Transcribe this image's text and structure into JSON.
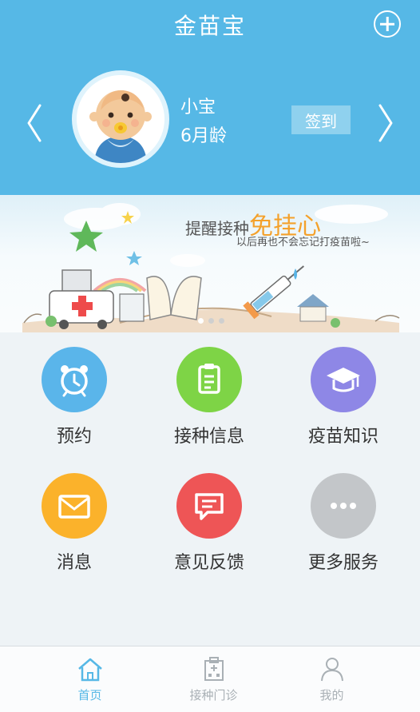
{
  "header": {
    "title": "金苗宝"
  },
  "profile": {
    "name": "小宝",
    "age": "6月龄",
    "checkin_label": "签到"
  },
  "banner": {
    "title_prefix": "提醒接种",
    "title_emphasis": "免挂心",
    "subtitle": "以后再也不会忘记打疫苗啦~",
    "slides": 3,
    "active_slide": 1
  },
  "grid": {
    "items": [
      {
        "label": "预约",
        "icon": "alarm-clock-icon",
        "color": "#5ab5ea"
      },
      {
        "label": "接种信息",
        "icon": "clipboard-icon",
        "color": "#7ed446"
      },
      {
        "label": "疫苗知识",
        "icon": "graduation-cap-icon",
        "color": "#8e87e6"
      },
      {
        "label": "消息",
        "icon": "envelope-icon",
        "color": "#fbb22b"
      },
      {
        "label": "意见反馈",
        "icon": "chat-bubble-icon",
        "color": "#ee5556"
      },
      {
        "label": "更多服务",
        "icon": "more-dots-icon",
        "color": "#c3c6c9"
      }
    ]
  },
  "tabbar": {
    "tabs": [
      {
        "label": "首页",
        "icon": "home-icon",
        "active": true
      },
      {
        "label": "接种门诊",
        "icon": "clinic-icon",
        "active": false
      },
      {
        "label": "我的",
        "icon": "user-icon",
        "active": false
      }
    ]
  },
  "colors": {
    "primary": "#56b8e6",
    "tab_active": "#56b8e6",
    "tab_inactive": "#a9b0b5"
  }
}
